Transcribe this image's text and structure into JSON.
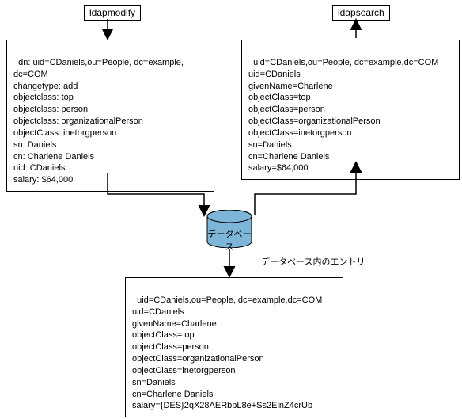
{
  "labels": {
    "ldapmodify": "ldapmodify",
    "ldapsearch": "ldapsearch",
    "database": "データベース",
    "db_entry_caption": "データベース内のエントリ"
  },
  "boxes": {
    "ldapmodify": "dn: uid=CDaniels,ou=People, dc=example,\ndc=COM\nchangetype: add\nobjectclass: top\nobjectclass: person\nobjectclass: organizationalPerson\nobjectClass: inetorgperson\nsn: Daniels\ncn: Charlene Daniels\nuid: CDaniels\nsalary: $64,000",
    "ldapsearch": "uid=CDaniels,ou=People, dc=example,dc=COM\nuid=CDaniels\ngivenName=Charlene\nobjectClass=top\nobjectClass=person\nobjectClass=organizationalPerson\nobjectClass=inetorgperson\nsn=Daniels\ncn=Charlene Daniels\nsalary=$64,000",
    "database_entry": "uid=CDaniels,ou=People, dc=example,dc=COM\nuid=CDaniels\ngivenName=Charlene\nobjectClass= op\nobjectClass=person\nobjectClass=organizationalPerson\nobjectClass=inetorgperson\nsn=Daniels\ncn=Charlene Daniels\nsalary={DES}2qX28AERbpL8e+Ss2ElnZ4crUb"
  }
}
